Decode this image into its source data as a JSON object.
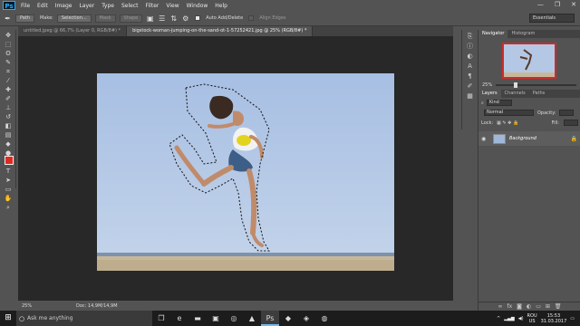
{
  "menu": {
    "logo": "Ps",
    "items": [
      "File",
      "Edit",
      "Image",
      "Layer",
      "Type",
      "Select",
      "Filter",
      "View",
      "Window",
      "Help"
    ],
    "window_controls": [
      "—",
      "❐",
      "✕"
    ]
  },
  "options": {
    "mode": "Path",
    "make_label": "Make:",
    "selection_btn": "Selection...",
    "mask_btn": "Mask",
    "shape_btn": "Shape",
    "auto_add_delete": "Auto Add/Delete",
    "align_edges": "Align Edges",
    "workspace": "Essentials"
  },
  "tabs": [
    {
      "label": "untitled.jpeg @ 66,7% (Layer 0, RGB/8#) *",
      "active": false
    },
    {
      "label": "bigstock-woman-jumping-on-the-sand-ot-1-57252421.jpg @ 25% (RGB/8#) *",
      "active": true
    }
  ],
  "status": {
    "zoom": "25%",
    "doc": "Doc: 14,9M/14,9M"
  },
  "navigator": {
    "tabs": [
      "Navigator",
      "Histogram"
    ],
    "zoom": "25%"
  },
  "layers_panel": {
    "tabs": [
      "Layers",
      "Channels",
      "Paths"
    ],
    "kind": "Kind",
    "blend": "Normal",
    "opacity_label": "Opacity:",
    "lock_label": "Lock:",
    "fill_label": "Fill:",
    "layer_name": "Background"
  },
  "taskbar": {
    "search_placeholder": "Ask me anything",
    "lang": "ROU",
    "region": "US",
    "time": "15:53",
    "date": "31.03.2017"
  },
  "colors": {
    "foreground": "#e02a20",
    "background": "#ffffff",
    "sky": "#b9cbe4",
    "sand": "#c8b89a"
  }
}
